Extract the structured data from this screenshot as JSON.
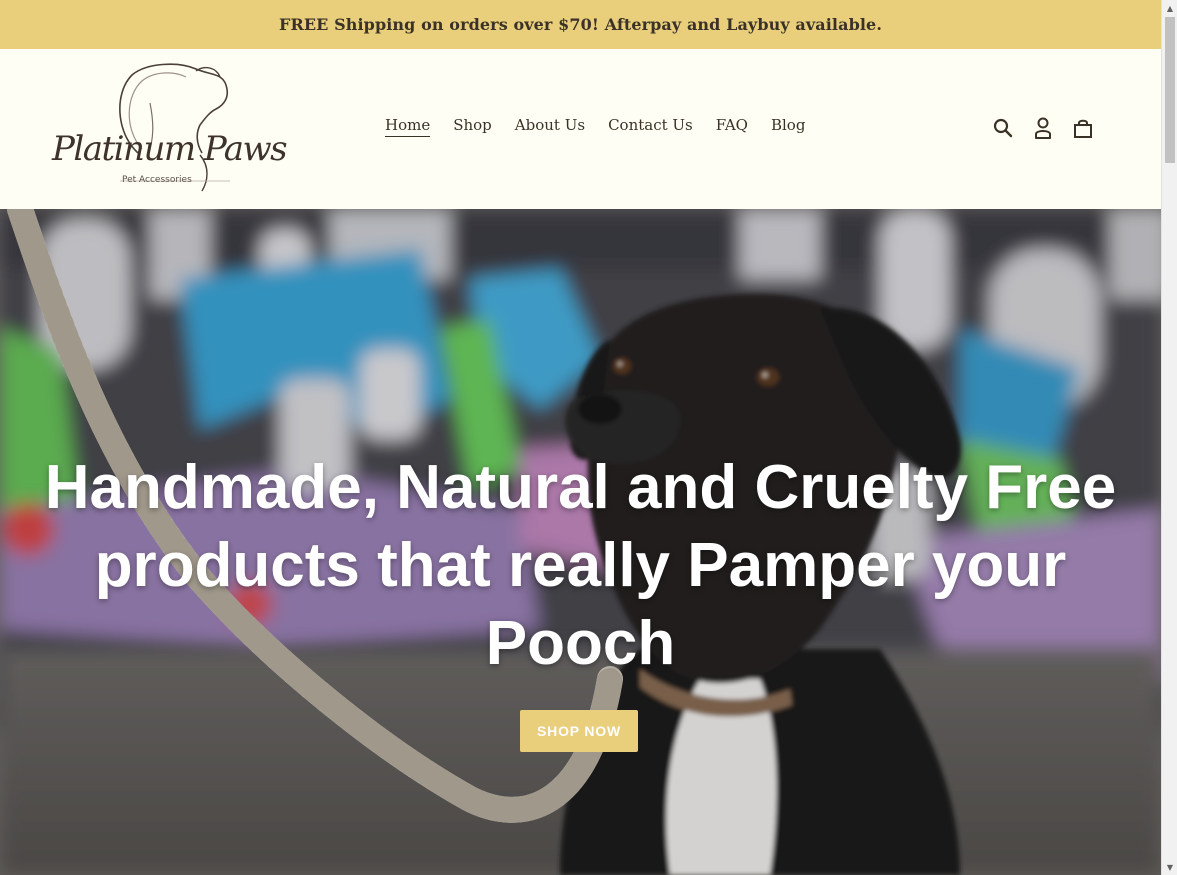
{
  "announcement": {
    "text": "FREE Shipping on orders over $70! Afterpay and Laybuy available."
  },
  "brand": {
    "name": "Platinum Paws",
    "tagline": "Pet Accessories"
  },
  "nav": {
    "items": [
      {
        "label": "Home",
        "active": true
      },
      {
        "label": "Shop",
        "active": false
      },
      {
        "label": "About Us",
        "active": false
      },
      {
        "label": "Contact Us",
        "active": false
      },
      {
        "label": "FAQ",
        "active": false
      },
      {
        "label": "Blog",
        "active": false
      }
    ]
  },
  "header_icons": [
    "search-icon",
    "account-icon",
    "cart-icon"
  ],
  "hero": {
    "title": "Handmade, Natural and Cruelty Free products that really Pamper your Pooch",
    "button_label": "SHOP NOW"
  },
  "colors": {
    "accent": "#e9cf7c",
    "header_bg": "#fffef5",
    "text": "#3a3226"
  }
}
